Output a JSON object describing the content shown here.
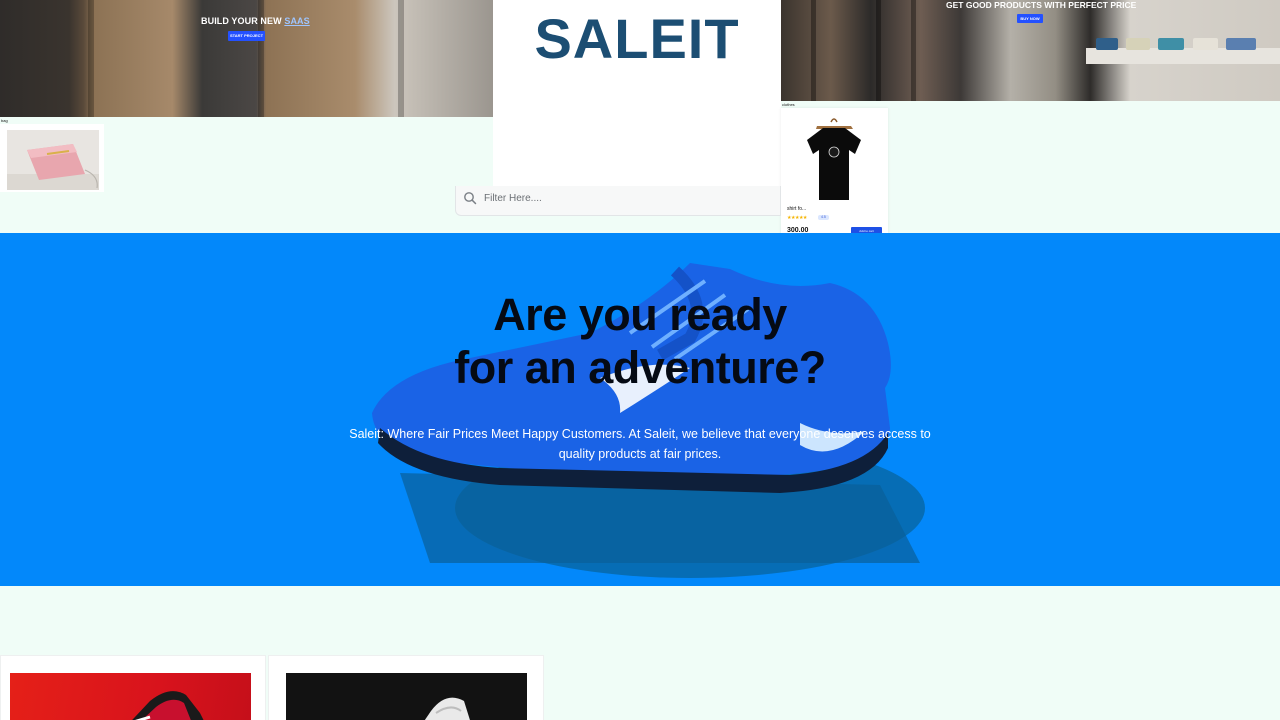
{
  "hero_top": {
    "left_banner": {
      "tagline_prefix": "BUILD YOUR NEW",
      "tagline_link": "SAAS",
      "button": "START PROJECT"
    },
    "logo": "SALEIT",
    "right_banner": {
      "tagline": "GET GOOD PRODUCTS WITH PERFECT PRICE",
      "button": "BUY NOW"
    }
  },
  "categories": {
    "bag": {
      "label": "bag"
    },
    "clothes": {
      "label": "clothes"
    }
  },
  "shirt_card": {
    "title": "shirt fo...",
    "stars": "★★★★★",
    "rating": "4.5",
    "price": "300.00",
    "add_button": "Add to cart"
  },
  "search": {
    "placeholder": "Filter Here...."
  },
  "hero": {
    "headline_line1": "Are you ready",
    "headline_line2": "for an adventure?",
    "subtext": "Saleit: Where Fair Prices Meet Happy Customers. At Saleit, we believe that everyone deserves access to quality products at fair prices."
  },
  "colors": {
    "accent": "#2451ff",
    "hero_bg": "#0388fa",
    "logo": "#1c4e73",
    "page_bg": "#f0fdf7"
  },
  "icons": {
    "search": "search-icon"
  }
}
